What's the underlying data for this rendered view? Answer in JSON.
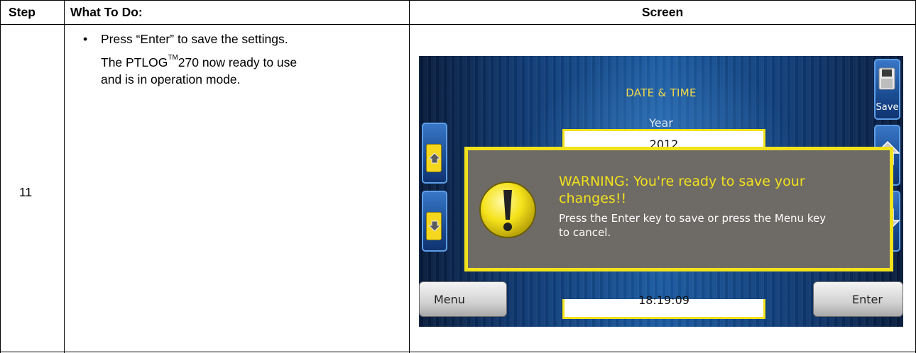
{
  "table": {
    "headers": {
      "step": "Step",
      "what": "What To Do:",
      "screen": "Screen"
    },
    "row": {
      "step": "11",
      "bullet": "•",
      "instruction_line1": "Press “Enter” to save the settings.",
      "instruction_line2_pre": "The PTLOG",
      "instruction_tm": "TM",
      "instruction_line2_post": "270 now ready to use",
      "instruction_line3": "and is in operation mode."
    }
  },
  "device": {
    "title": "DATE & TIME",
    "field_label": "Year",
    "field_value": "2012",
    "time_value_partial": "18:19:09",
    "save_label": "Save",
    "menu_label": "Menu",
    "enter_label": "Enter",
    "warning_title": "WARNING: You're ready to save your changes!!",
    "warning_message": "Press the Enter key to save or press the Menu key to cancel.",
    "icons": [
      "up-arrow-icon",
      "down-arrow-icon",
      "save-icon",
      "warning-icon"
    ],
    "colors": {
      "highlight": "#f2e21c",
      "dialog": "#6e6a66",
      "screen_blue": "#1a5aa0"
    }
  }
}
